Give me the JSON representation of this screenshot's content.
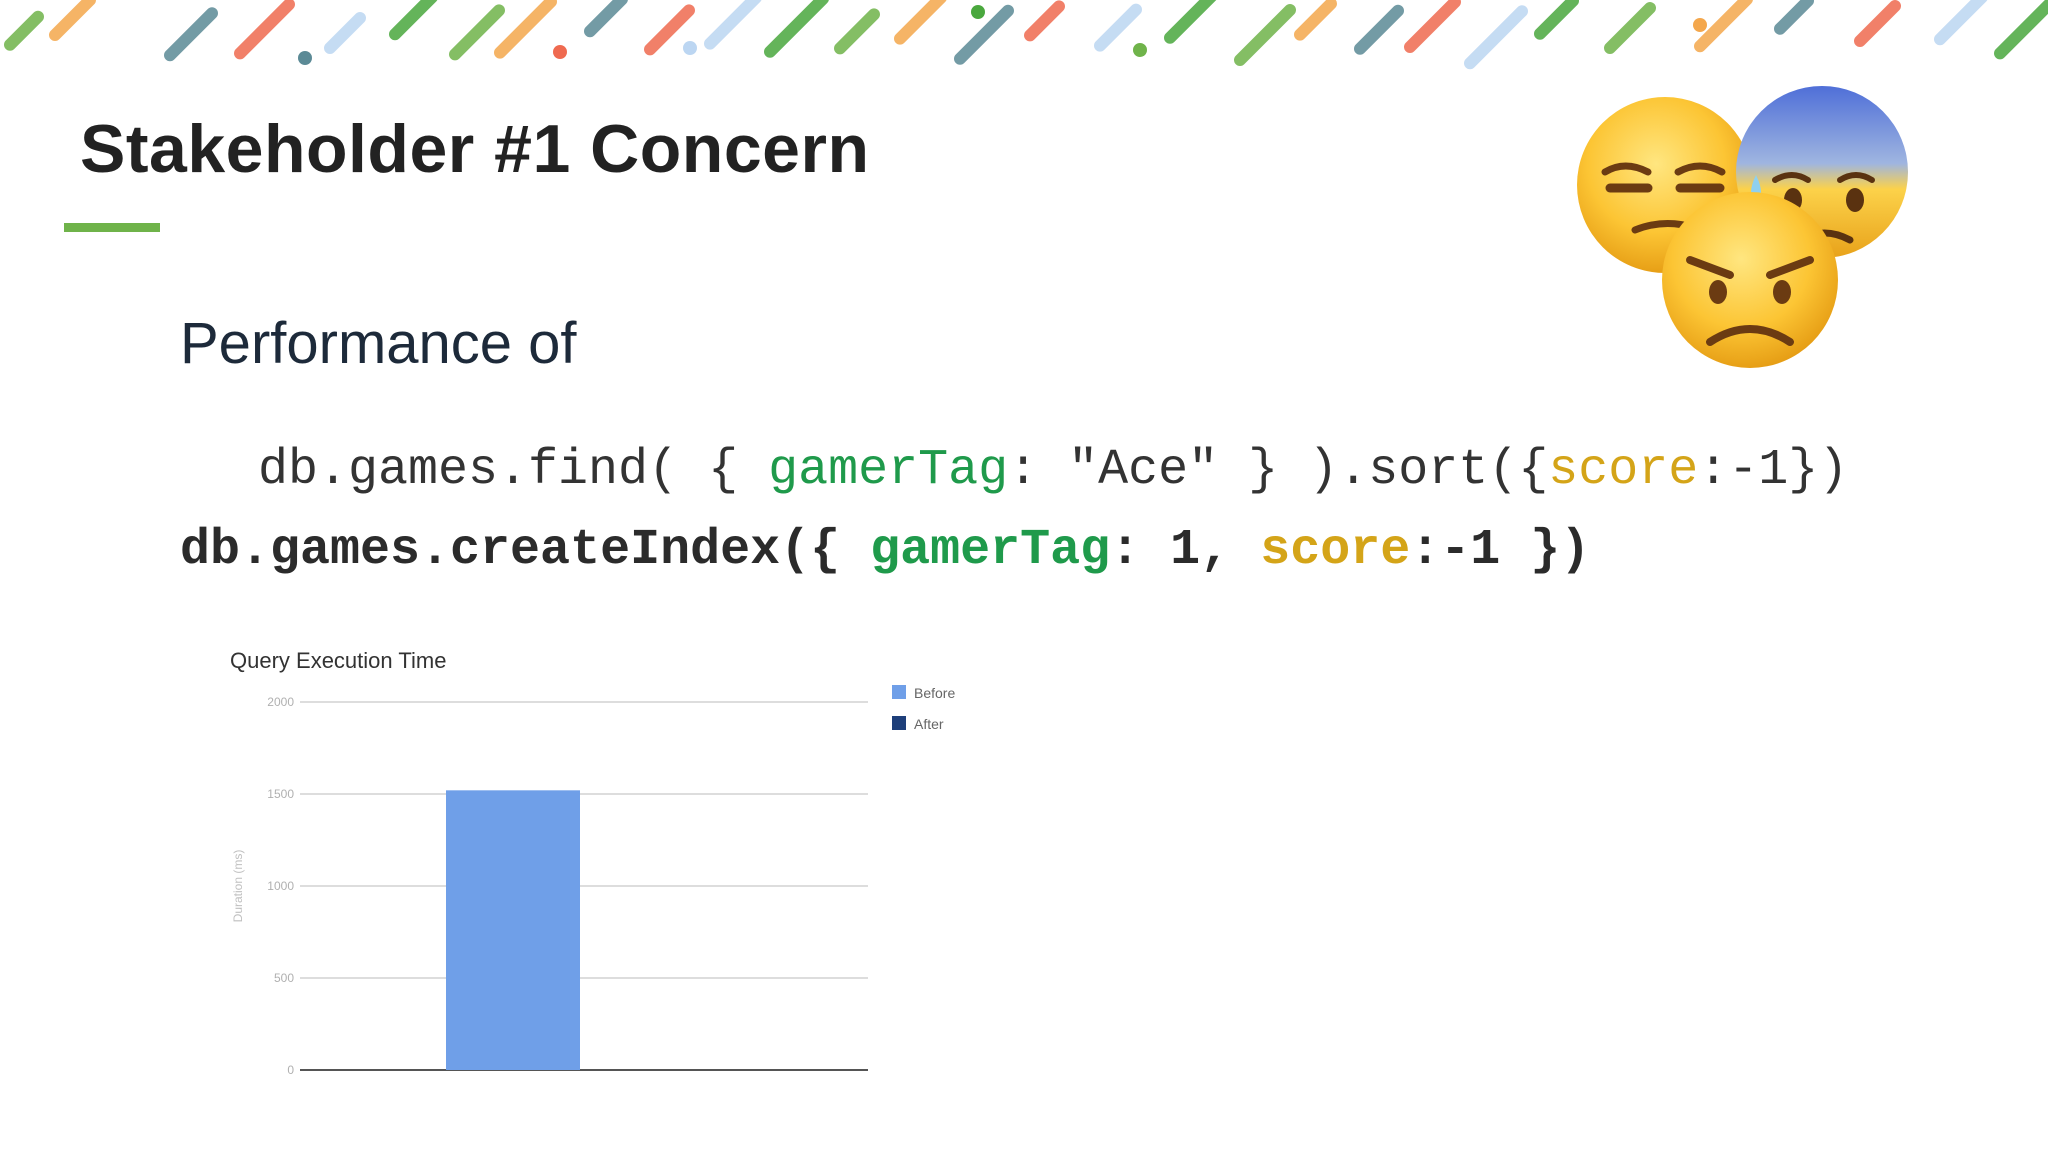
{
  "slide": {
    "title": "Stakeholder #1 Concern",
    "subtitle": "Performance of",
    "colors": {
      "accent": "#6fb34a",
      "title": "#222222",
      "green_token": "#1f9a4b",
      "yellow_token": "#d4a418"
    }
  },
  "code_find": {
    "part1": "db.games.find( { ",
    "field": "gamerTag",
    "part2": ": \"Ace\" } ).sort({",
    "sort_field": "score",
    "part3": ":-1})"
  },
  "code_index": {
    "part1": "db.games.createIndex({ ",
    "field": "gamerTag",
    "part2": ": 1, ",
    "sort_field": "score",
    "part3": ":-1 })"
  },
  "decor": {
    "header_stripes": "diagonal-confetti-stripes",
    "emoji": [
      "unamused-face-emoji",
      "anxious-face-with-sweat-emoji",
      "pouting-face-emoji"
    ]
  },
  "chart_data": {
    "type": "bar",
    "title": "Query Execution Time",
    "ylabel": "Duration (ms)",
    "xlabel": "",
    "ylim": [
      0,
      2000
    ],
    "yticks": [
      "0",
      "500",
      "1000",
      "1500",
      "2000"
    ],
    "grid": true,
    "legend_position": "right",
    "series": [
      {
        "name": "Before",
        "values": [
          1520
        ],
        "color": "#6f9fe8"
      },
      {
        "name": "After",
        "values": [
          null
        ],
        "color": "#1e3f7a"
      }
    ]
  }
}
